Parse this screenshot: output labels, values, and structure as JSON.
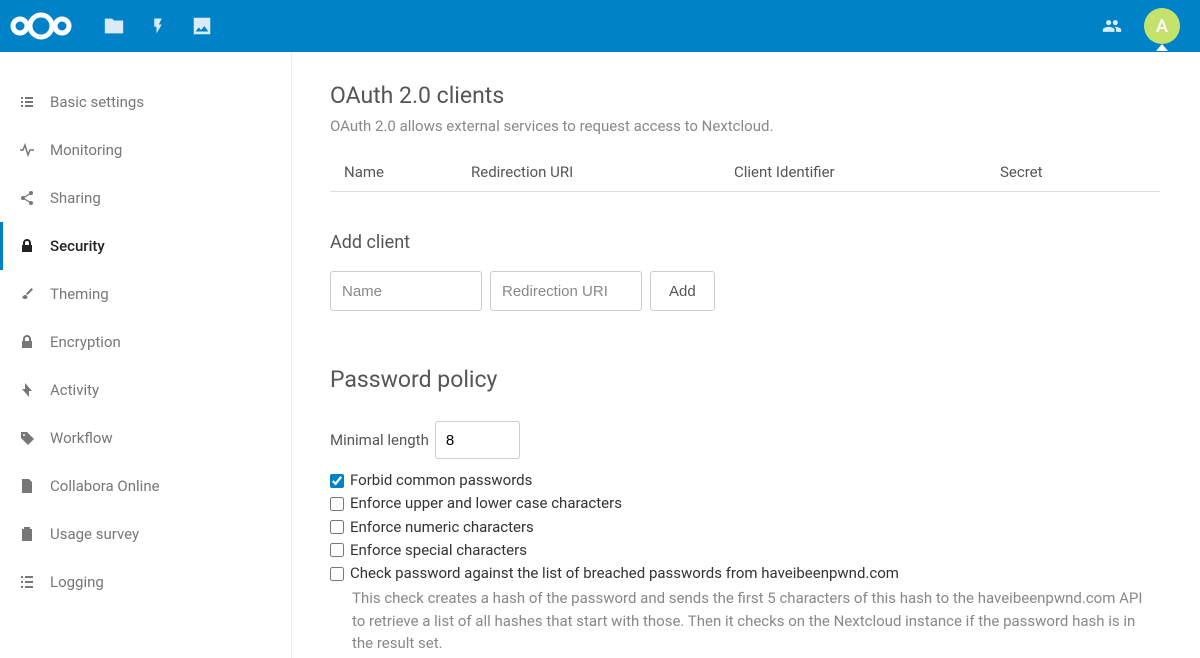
{
  "header": {
    "avatar_letter": "A"
  },
  "sidebar": {
    "items": [
      {
        "label": "Basic settings",
        "icon": "list"
      },
      {
        "label": "Monitoring",
        "icon": "pulse"
      },
      {
        "label": "Sharing",
        "icon": "share"
      },
      {
        "label": "Security",
        "icon": "lock",
        "active": true
      },
      {
        "label": "Theming",
        "icon": "brush"
      },
      {
        "label": "Encryption",
        "icon": "lock2"
      },
      {
        "label": "Activity",
        "icon": "bolt"
      },
      {
        "label": "Workflow",
        "icon": "tag"
      },
      {
        "label": "Collabora Online",
        "icon": "doc"
      },
      {
        "label": "Usage survey",
        "icon": "clipboard"
      },
      {
        "label": "Logging",
        "icon": "listnum"
      }
    ]
  },
  "oauth": {
    "title": "OAuth 2.0 clients",
    "desc": "OAuth 2.0 allows external services to request access to Nextcloud.",
    "columns": {
      "name": "Name",
      "redirect": "Redirection URI",
      "client_id": "Client Identifier",
      "secret": "Secret"
    },
    "add_title": "Add client",
    "name_placeholder": "Name",
    "redir_placeholder": "Redirection URI",
    "add_button": "Add"
  },
  "password_policy": {
    "title": "Password policy",
    "min_length_label": "Minimal length",
    "min_length_value": "8",
    "checks": [
      {
        "label": "Forbid common passwords",
        "checked": true
      },
      {
        "label": "Enforce upper and lower case characters",
        "checked": false
      },
      {
        "label": "Enforce numeric characters",
        "checked": false
      },
      {
        "label": "Enforce special characters",
        "checked": false
      },
      {
        "label": "Check password against the list of breached passwords from haveibeenpwnd.com",
        "checked": false
      }
    ],
    "hibp_hint": "This check creates a hash of the password and sends the first 5 characters of this hash to the haveibeenpwnd.com API to retrieve a list of all hashes that start with those. Then it checks on the Nextcloud instance if the password hash is in the result set."
  }
}
